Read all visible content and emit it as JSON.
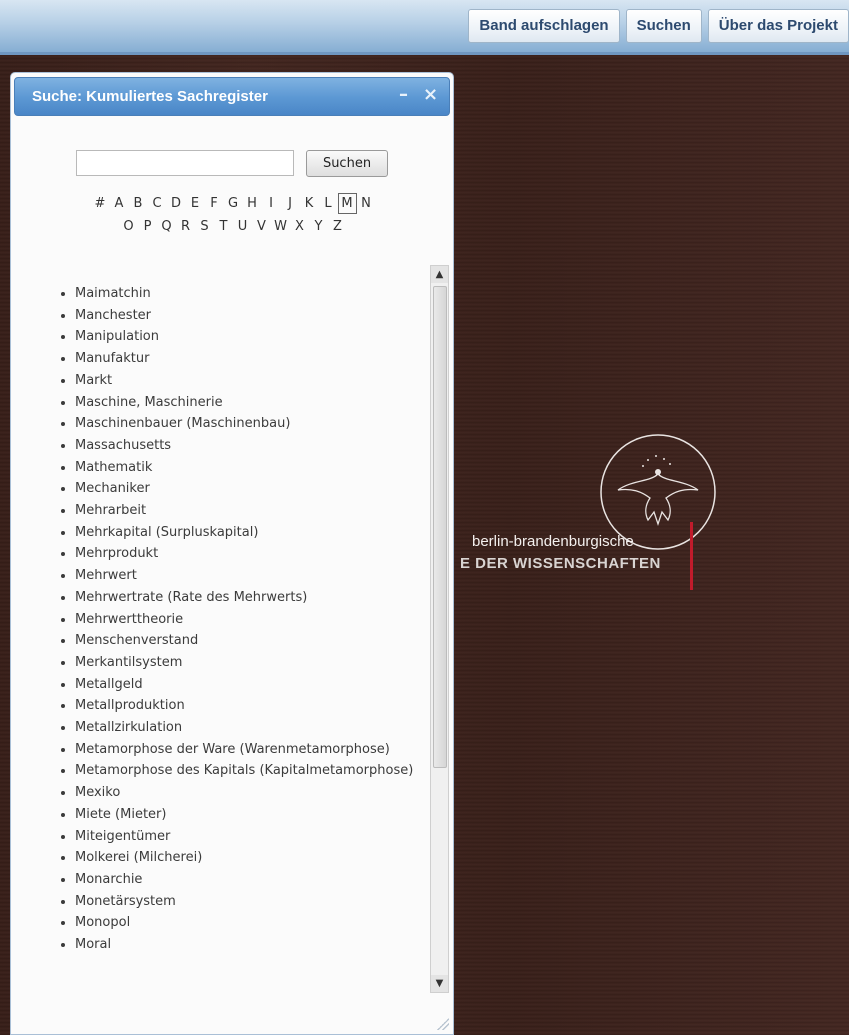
{
  "topbar": {
    "nav": [
      {
        "label": "Band aufschlagen"
      },
      {
        "label": "Suchen"
      },
      {
        "label": "Über das Projekt"
      }
    ]
  },
  "panel": {
    "title": "Suche: Kumuliertes Sachregister",
    "minimize_icon": "minimize-icon",
    "close_icon": "close-icon",
    "search": {
      "value": "",
      "placeholder": "",
      "button_label": "Suchen"
    },
    "alphabet_row1": [
      "#",
      "A",
      "B",
      "C",
      "D",
      "E",
      "F",
      "G",
      "H",
      "I",
      "J",
      "K",
      "L",
      "M",
      "N"
    ],
    "alphabet_row2": [
      "O",
      "P",
      "Q",
      "R",
      "S",
      "T",
      "U",
      "V",
      "W",
      "X",
      "Y",
      "Z"
    ],
    "selected_letter": "M",
    "entries": [
      "Maimatchin",
      "Manchester",
      "Manipulation",
      "Manufaktur",
      "Markt",
      "Maschine, Maschinerie",
      "Maschinenbauer (Maschinenbau)",
      "Massachusetts",
      "Mathematik",
      "Mechaniker",
      "Mehrarbeit",
      "Mehrkapital (Surpluskapital)",
      "Mehrprodukt",
      "Mehrwert",
      "Mehrwertrate (Rate des Mehrwerts)",
      "Mehrwerttheorie",
      "Menschenverstand",
      "Merkantilsystem",
      "Metallgeld",
      "Metallproduktion",
      "Metallzirkulation",
      "Metamorphose der Ware (Warenmetamorphose)",
      "Metamorphose des Kapitals (Kapitalmetamorphose)",
      "Mexiko",
      "Miete (Mieter)",
      "Miteigentümer",
      "Molkerei (Milcherei)",
      "Monarchie",
      "Monetärsystem",
      "Monopol",
      "Moral"
    ]
  },
  "background_logo": {
    "line1": "berlin-brandenburgische",
    "line2": "E DER WISSENSCHAFTEN"
  }
}
